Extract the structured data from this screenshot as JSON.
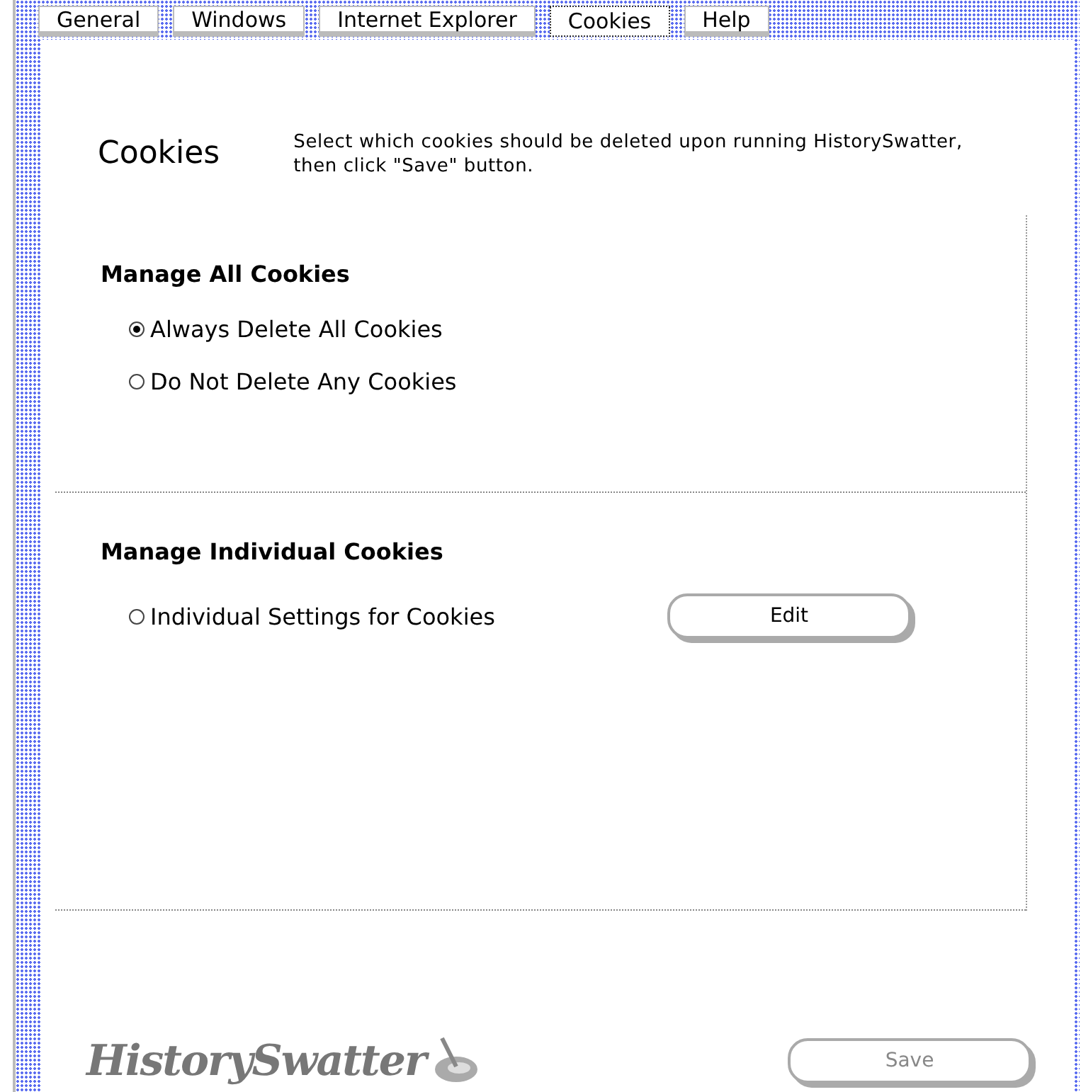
{
  "tabs": [
    {
      "label": "General",
      "selected": false
    },
    {
      "label": "Windows",
      "selected": false
    },
    {
      "label": "Internet Explorer",
      "selected": false
    },
    {
      "label": "Cookies",
      "selected": true
    },
    {
      "label": "Help",
      "selected": false
    }
  ],
  "page": {
    "title": "Cookies",
    "description": "Select which cookies should be deleted upon running HistorySwatter, then click \"Save\" button."
  },
  "sections": [
    {
      "heading": "Manage All Cookies",
      "options": [
        {
          "label": "Always Delete All Cookies",
          "selected": true
        },
        {
          "label": "Do Not Delete Any Cookies",
          "selected": false
        }
      ]
    },
    {
      "heading": "Manage Individual Cookies",
      "options": [
        {
          "label": "Individual Settings for Cookies",
          "selected": false,
          "button": "Edit"
        }
      ]
    }
  ],
  "footer": {
    "logo": "HistorySwatter",
    "save": {
      "label": "Save",
      "disabled": true
    }
  }
}
